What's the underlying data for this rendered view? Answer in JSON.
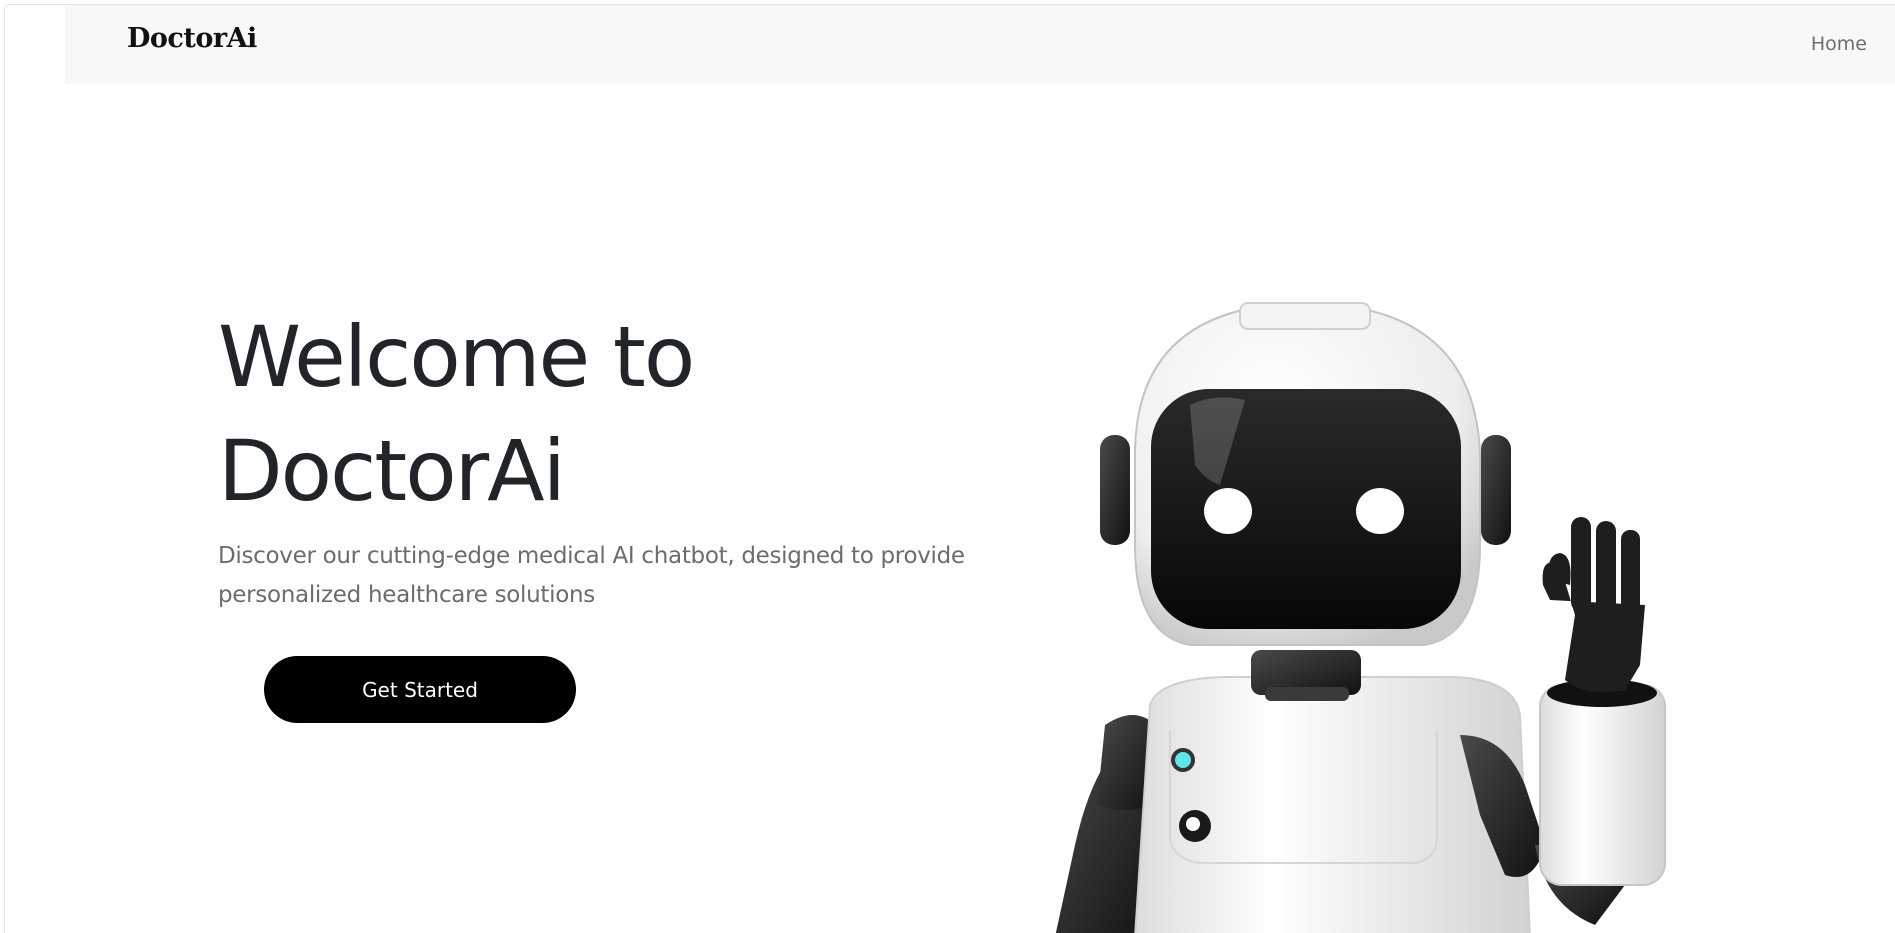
{
  "nav": {
    "brand": "DoctorAi",
    "links": [
      {
        "label": "Home"
      }
    ]
  },
  "hero": {
    "title_line1": "Welcome to",
    "title_line2": "DoctorAi",
    "subtitle": "Discover our cutting-edge medical AI chatbot, designed to provide personalized healthcare solutions",
    "cta_label": "Get Started"
  },
  "illustration": {
    "icon": "waving-robot-illustration"
  },
  "colors": {
    "navbar_bg": "#f7f8f9",
    "title": "#212529",
    "subtitle": "#6c6c6c",
    "button_bg": "#000000",
    "button_text": "#ffffff",
    "robot_accent": "#5fe6e6"
  }
}
